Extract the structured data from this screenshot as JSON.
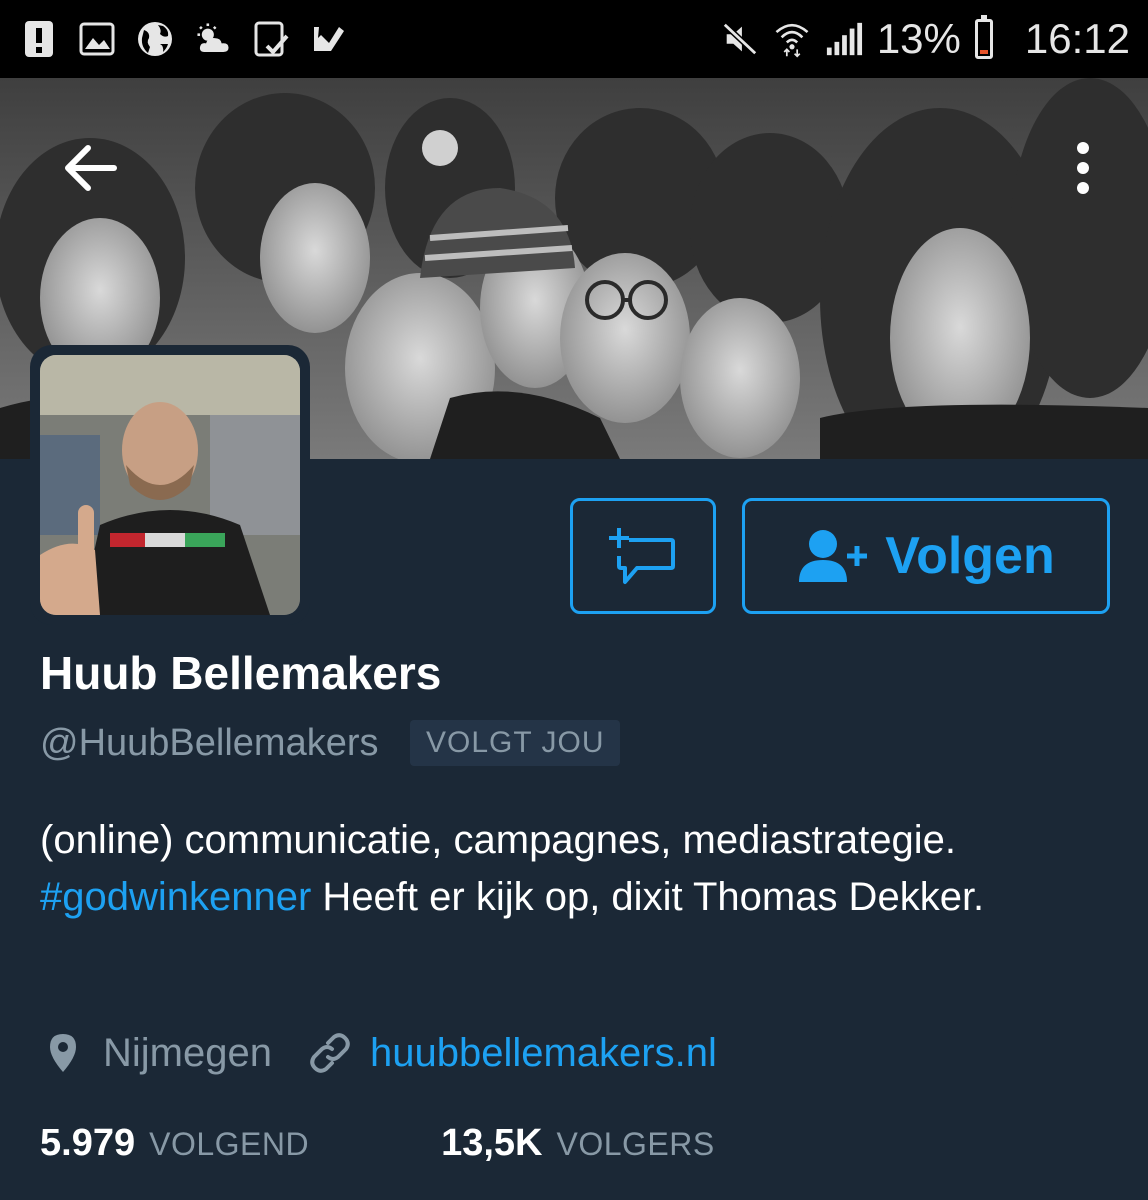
{
  "status_bar": {
    "left_icons": [
      "alert-icon",
      "image-icon",
      "globe-icon",
      "weather-icon",
      "tablet-check-icon",
      "checkmark-icon"
    ],
    "right_icons": [
      "mute-icon",
      "wifi-icon",
      "signal-icon",
      "battery-icon"
    ],
    "battery_percent": "13%",
    "battery_level": 0.13,
    "time": "16:12"
  },
  "header": {
    "back_icon": "arrow-left-icon",
    "more_icon": "more-vertical-icon"
  },
  "actions": {
    "dm_icon": "message-plus-icon",
    "follow_icon": "person-add-icon",
    "follow_label": "Volgen"
  },
  "profile": {
    "name": "Huub Bellemakers",
    "handle": "@HuubBellemakers",
    "follows_you": "VOLGT JOU",
    "bio_part1": "(online) communicatie, campagnes, mediastrategie. ",
    "bio_hashtag": "#godwinkenner",
    "bio_part2": " Heeft er kijk op, dixit Thomas Dekker.",
    "location": "Nijmegen",
    "website": "huubbellemakers.nl"
  },
  "stats": {
    "following_count": "5.979",
    "following_label": "VOLGEND",
    "followers_count": "13,5K",
    "followers_label": "VOLGERS"
  },
  "colors": {
    "background": "#1b2836",
    "accent": "#1da1f2",
    "secondary_text": "#8899a6",
    "battery_low": "#e8542a"
  }
}
